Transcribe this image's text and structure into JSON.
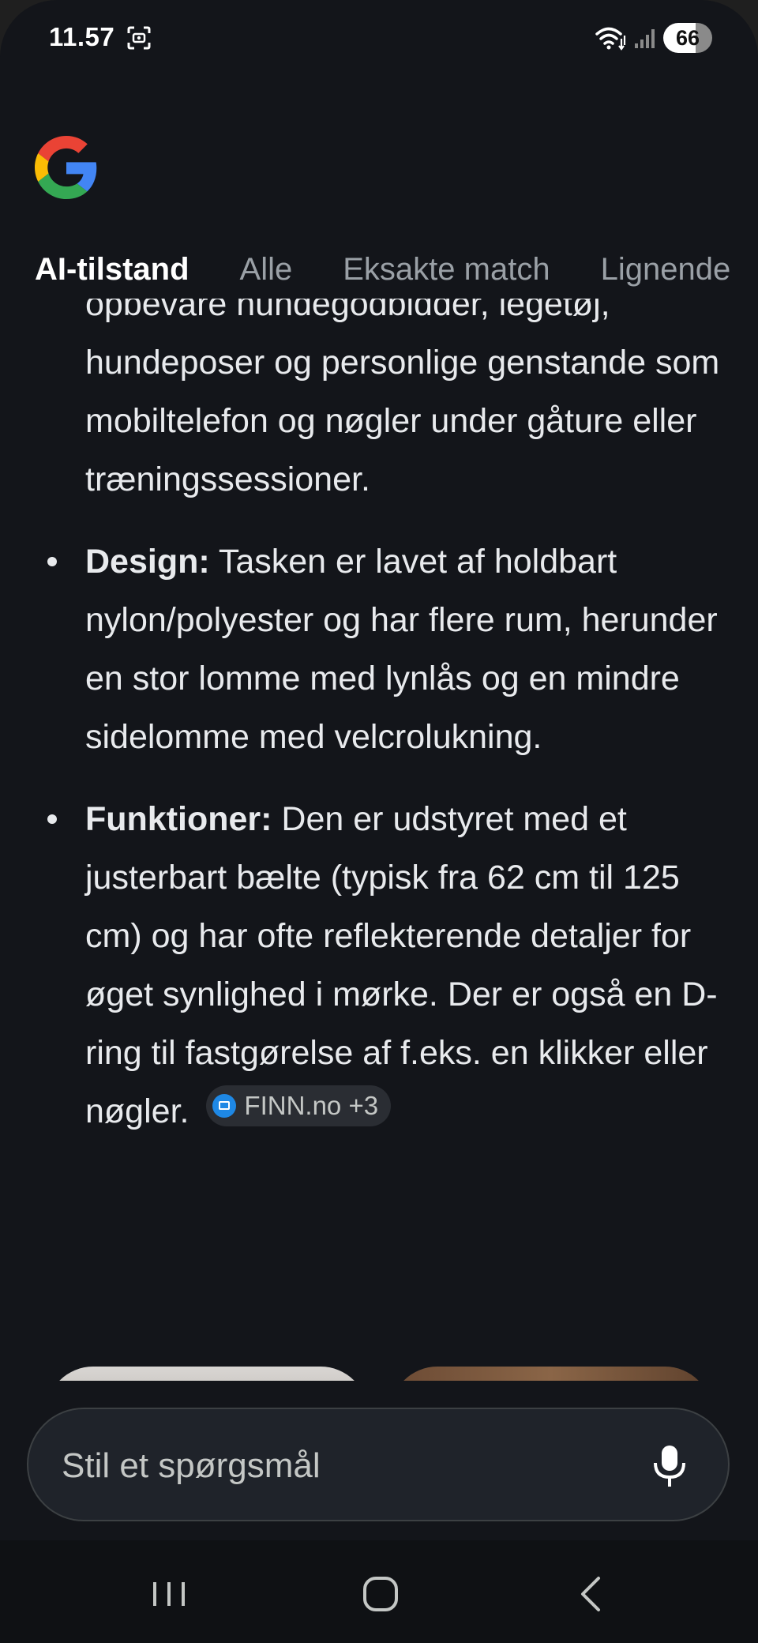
{
  "status_bar": {
    "time": "11.57",
    "battery": "66"
  },
  "colors": {
    "background": "#13151a",
    "text": "#e8eaed",
    "muted_text": "#9aa0a6",
    "chip_bg": "#2a2d33",
    "ask_bar_bg": "#1f232a"
  },
  "logo": {
    "icon": "google-g-icon"
  },
  "tabs": [
    {
      "label": "AI-tilstand",
      "active": true
    },
    {
      "label": "Alle",
      "active": false
    },
    {
      "label": "Eksakte match",
      "active": false
    },
    {
      "label": "Lignende",
      "active": false
    }
  ],
  "content": {
    "intro_text": "opbevare hundegodbidder, legetøj, hundeposer og personlige genstande som mobiltelefon og nøgler under gåture eller træningssessioner.",
    "bullets": [
      {
        "title": "Design:",
        "text": " Tasken er lavet af holdbart nylon/polyester og har flere rum, herunder en stor lomme med lynlås og en mindre sidelomme med velcrolukning."
      },
      {
        "title": "Funktioner:",
        "text": " Den er udstyret med et justerbart bælte (typisk fra 62 cm til 125 cm) og har ofte reflekterende detaljer for øget synlighed i mørke. Der er også en D-ring til fastgørelse af f.eks. en klikker eller nøgler."
      }
    ],
    "source_chip": "FINN.no +3"
  },
  "ask_bar": {
    "placeholder": "Stil et spørgsmål",
    "mic_icon": "microphone-icon"
  },
  "nav_bar": {
    "recents_icon": "recents-icon",
    "home_icon": "home-icon",
    "back_icon": "back-icon"
  }
}
